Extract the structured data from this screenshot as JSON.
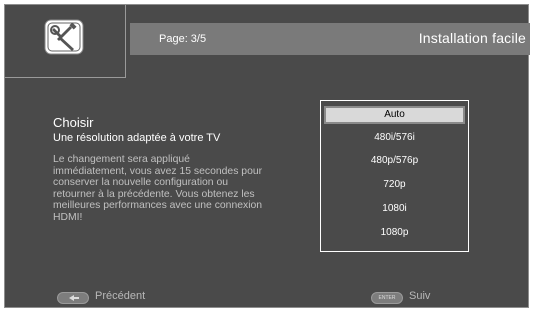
{
  "header": {
    "page_indicator": "Page: 3/5",
    "title": "Installation facile"
  },
  "logo": {
    "icon": "wrench-screwdriver-icon"
  },
  "content": {
    "heading": "Choisir",
    "subheading": "Une résolution adaptée à votre TV",
    "description_lines": [
      "Le changement sera appliqué",
      "immédiatement, vous avez 15 secondes pour",
      "conserver la nouvelle configuration ou",
      "retourner à la précédente. Vous obtenez les",
      "meilleures performances avec une connexion",
      "HDMI!"
    ]
  },
  "resolution_options": {
    "selected": "Auto",
    "items": [
      "Auto",
      "480i/576i",
      "480p/576p",
      "720p",
      "1080i",
      "1080p"
    ]
  },
  "footer": {
    "back": {
      "key": "back-key-icon",
      "label": "Précédent"
    },
    "next": {
      "key_text": "ENTER",
      "label": "Suiv"
    }
  },
  "colors": {
    "background": "#4a4a4a",
    "header_bar": "#7a7a7a",
    "selected_option": "#d9d9d9"
  }
}
